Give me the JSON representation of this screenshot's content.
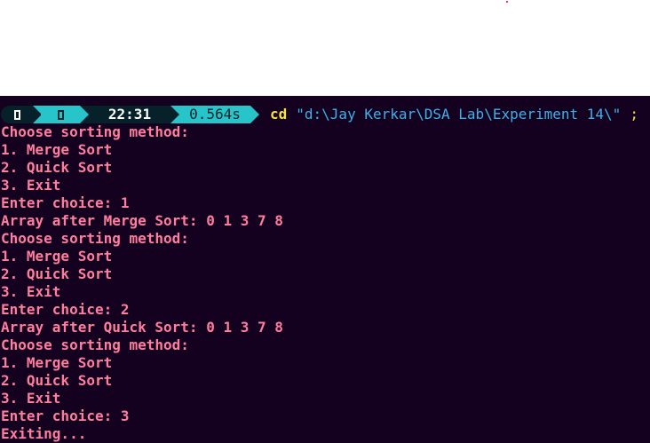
{
  "window": {
    "top_area_color": "#ffffff",
    "terminal_bg": "#14001f"
  },
  "prompt": {
    "segment1_icon": "box-glyph-icon",
    "segment2_icon": "box-glyph-icon",
    "time": "22:31",
    "duration": "0.564s",
    "command": "cd",
    "command_arg": "\"d:\\Jay Kerkar\\DSA Lab\\Experiment 14\\\"",
    "command_tail": ";",
    "colors": {
      "dark": "#07212b",
      "cyan": "#27c5c9",
      "command": "#f5e23a",
      "argument": "#3fb0e8"
    }
  },
  "output": {
    "color": "#ff7e9d",
    "lines": [
      "Choose sorting method:",
      "1. Merge Sort",
      "2. Quick Sort",
      "3. Exit",
      "Enter choice: 1",
      "Array after Merge Sort: 0 1 3 7 8",
      "Choose sorting method:",
      "1. Merge Sort",
      "2. Quick Sort",
      "3. Exit",
      "Enter choice: 2",
      "Array after Quick Sort: 0 1 3 7 8",
      "Choose sorting method:",
      "1. Merge Sort",
      "2. Quick Sort",
      "3. Exit",
      "Enter choice: 3",
      "Exiting..."
    ]
  }
}
